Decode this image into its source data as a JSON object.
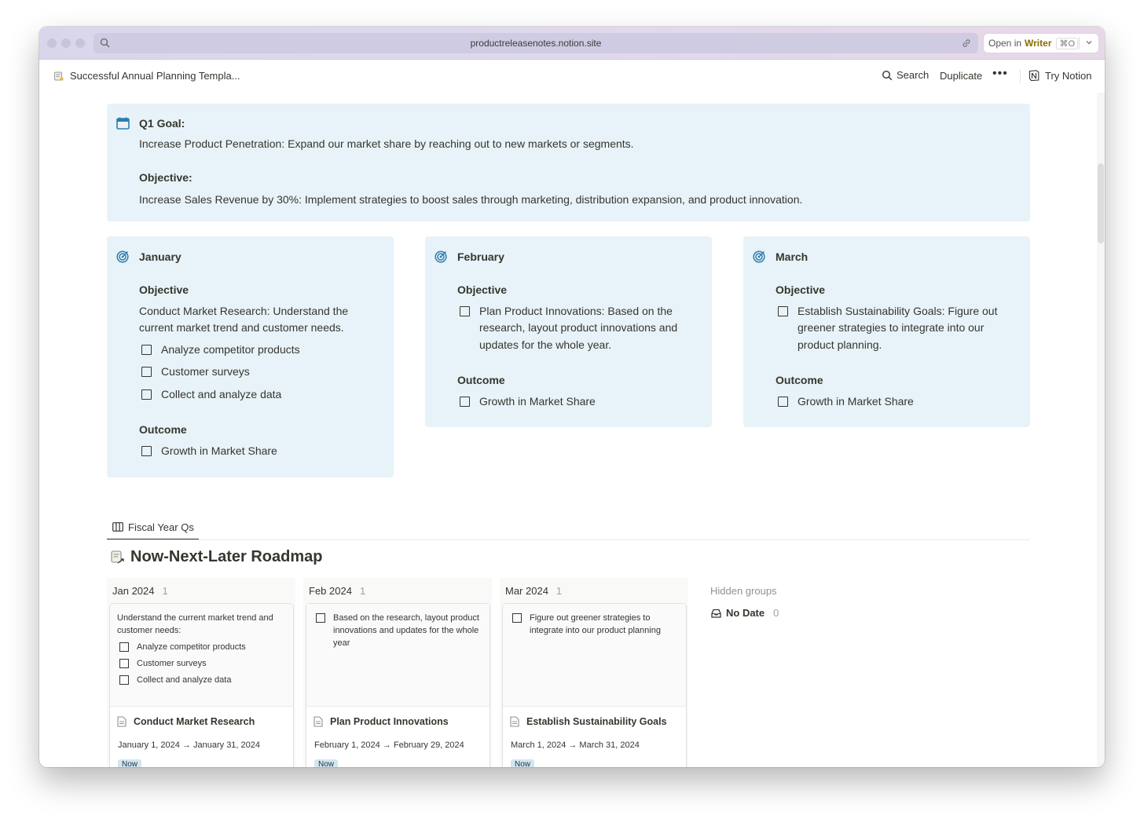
{
  "browser": {
    "url": "productreleasenotes.notion.site",
    "open_in_prefix": "Open in",
    "open_in_app": "Writer",
    "open_in_shortcut": "⌘O"
  },
  "topbar": {
    "page_title": "Successful Annual Planning Templa...",
    "search_label": "Search",
    "duplicate_label": "Duplicate",
    "more_label": "•••",
    "try_notion_label": "Try Notion"
  },
  "goal": {
    "label": "Q1 Goal:",
    "text": "Increase Product Penetration: Expand our market share by reaching out to new markets or segments.",
    "objective_label": "Objective:",
    "objective_text": "Increase Sales Revenue by 30%: Implement strategies to boost sales through marketing, distribution expansion, and product innovation."
  },
  "months": {
    "jan": {
      "title": "January",
      "objective_heading": "Objective",
      "objective_text": "Conduct Market Research: Understand the current market trend and customer needs.",
      "tasks": [
        "Analyze competitor products",
        "Customer surveys",
        "Collect and analyze data"
      ],
      "outcome_heading": "Outcome",
      "outcome": "Growth in Market Share"
    },
    "feb": {
      "title": "February",
      "objective_heading": "Objective",
      "objective_task": "Plan Product Innovations: Based on the research, layout product innovations and updates for the whole year.",
      "outcome_heading": "Outcome",
      "outcome": "Growth in Market Share"
    },
    "mar": {
      "title": "March",
      "objective_heading": "Objective",
      "objective_task": "Establish Sustainability Goals: Figure out greener strategies to integrate into our product planning.",
      "outcome_heading": "Outcome",
      "outcome": "Growth in Market Share"
    }
  },
  "view": {
    "tab_label": "Fiscal Year Qs",
    "db_title": "Now-Next-Later Roadmap"
  },
  "board": {
    "columns": [
      {
        "header": "Jan 2024",
        "count": "1",
        "card": {
          "intro": "Understand the current market trend and customer needs:",
          "checks": [
            "Analyze competitor products",
            "Customer surveys",
            "Collect and analyze data"
          ],
          "name": "Conduct Market Research",
          "date": "January 1, 2024 → January 31, 2024",
          "tag": "Now"
        }
      },
      {
        "header": "Feb 2024",
        "count": "1",
        "card": {
          "checks": [
            "Based on the research, layout product innovations and updates for the whole year"
          ],
          "name": "Plan Product Innovations",
          "date": "February 1, 2024 → February 29, 2024",
          "tag": "Now"
        }
      },
      {
        "header": "Mar 2024",
        "count": "1",
        "card": {
          "checks": [
            "Figure out greener strategies to integrate into our product planning"
          ],
          "name": "Establish Sustainability Goals",
          "date": "March 1, 2024 → March 31, 2024",
          "tag": "Now"
        }
      }
    ],
    "hidden_groups_label": "Hidden groups",
    "no_date_label": "No Date",
    "no_date_count": "0"
  },
  "colors": {
    "callout_bg": "#e7f3f8",
    "icon_blue": "#2e7db0",
    "tag_bg": "#d3e5ef"
  }
}
